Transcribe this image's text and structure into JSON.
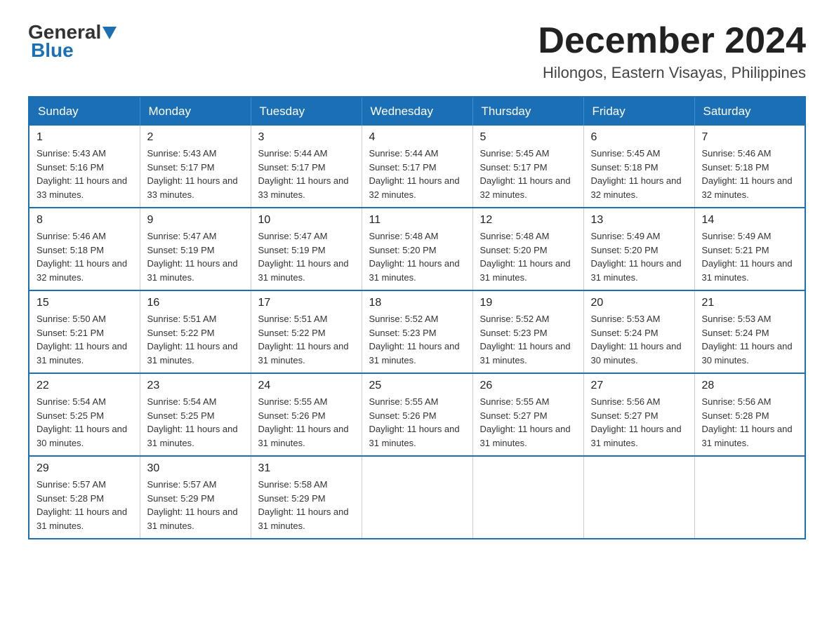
{
  "header": {
    "logo_general": "General",
    "logo_blue": "Blue",
    "title": "December 2024",
    "subtitle": "Hilongos, Eastern Visayas, Philippines"
  },
  "calendar": {
    "days_of_week": [
      "Sunday",
      "Monday",
      "Tuesday",
      "Wednesday",
      "Thursday",
      "Friday",
      "Saturday"
    ],
    "weeks": [
      [
        {
          "day": "1",
          "sunrise": "5:43 AM",
          "sunset": "5:16 PM",
          "daylight": "11 hours and 33 minutes."
        },
        {
          "day": "2",
          "sunrise": "5:43 AM",
          "sunset": "5:17 PM",
          "daylight": "11 hours and 33 minutes."
        },
        {
          "day": "3",
          "sunrise": "5:44 AM",
          "sunset": "5:17 PM",
          "daylight": "11 hours and 33 minutes."
        },
        {
          "day": "4",
          "sunrise": "5:44 AM",
          "sunset": "5:17 PM",
          "daylight": "11 hours and 32 minutes."
        },
        {
          "day": "5",
          "sunrise": "5:45 AM",
          "sunset": "5:17 PM",
          "daylight": "11 hours and 32 minutes."
        },
        {
          "day": "6",
          "sunrise": "5:45 AM",
          "sunset": "5:18 PM",
          "daylight": "11 hours and 32 minutes."
        },
        {
          "day": "7",
          "sunrise": "5:46 AM",
          "sunset": "5:18 PM",
          "daylight": "11 hours and 32 minutes."
        }
      ],
      [
        {
          "day": "8",
          "sunrise": "5:46 AM",
          "sunset": "5:18 PM",
          "daylight": "11 hours and 32 minutes."
        },
        {
          "day": "9",
          "sunrise": "5:47 AM",
          "sunset": "5:19 PM",
          "daylight": "11 hours and 31 minutes."
        },
        {
          "day": "10",
          "sunrise": "5:47 AM",
          "sunset": "5:19 PM",
          "daylight": "11 hours and 31 minutes."
        },
        {
          "day": "11",
          "sunrise": "5:48 AM",
          "sunset": "5:20 PM",
          "daylight": "11 hours and 31 minutes."
        },
        {
          "day": "12",
          "sunrise": "5:48 AM",
          "sunset": "5:20 PM",
          "daylight": "11 hours and 31 minutes."
        },
        {
          "day": "13",
          "sunrise": "5:49 AM",
          "sunset": "5:20 PM",
          "daylight": "11 hours and 31 minutes."
        },
        {
          "day": "14",
          "sunrise": "5:49 AM",
          "sunset": "5:21 PM",
          "daylight": "11 hours and 31 minutes."
        }
      ],
      [
        {
          "day": "15",
          "sunrise": "5:50 AM",
          "sunset": "5:21 PM",
          "daylight": "11 hours and 31 minutes."
        },
        {
          "day": "16",
          "sunrise": "5:51 AM",
          "sunset": "5:22 PM",
          "daylight": "11 hours and 31 minutes."
        },
        {
          "day": "17",
          "sunrise": "5:51 AM",
          "sunset": "5:22 PM",
          "daylight": "11 hours and 31 minutes."
        },
        {
          "day": "18",
          "sunrise": "5:52 AM",
          "sunset": "5:23 PM",
          "daylight": "11 hours and 31 minutes."
        },
        {
          "day": "19",
          "sunrise": "5:52 AM",
          "sunset": "5:23 PM",
          "daylight": "11 hours and 31 minutes."
        },
        {
          "day": "20",
          "sunrise": "5:53 AM",
          "sunset": "5:24 PM",
          "daylight": "11 hours and 30 minutes."
        },
        {
          "day": "21",
          "sunrise": "5:53 AM",
          "sunset": "5:24 PM",
          "daylight": "11 hours and 30 minutes."
        }
      ],
      [
        {
          "day": "22",
          "sunrise": "5:54 AM",
          "sunset": "5:25 PM",
          "daylight": "11 hours and 30 minutes."
        },
        {
          "day": "23",
          "sunrise": "5:54 AM",
          "sunset": "5:25 PM",
          "daylight": "11 hours and 31 minutes."
        },
        {
          "day": "24",
          "sunrise": "5:55 AM",
          "sunset": "5:26 PM",
          "daylight": "11 hours and 31 minutes."
        },
        {
          "day": "25",
          "sunrise": "5:55 AM",
          "sunset": "5:26 PM",
          "daylight": "11 hours and 31 minutes."
        },
        {
          "day": "26",
          "sunrise": "5:55 AM",
          "sunset": "5:27 PM",
          "daylight": "11 hours and 31 minutes."
        },
        {
          "day": "27",
          "sunrise": "5:56 AM",
          "sunset": "5:27 PM",
          "daylight": "11 hours and 31 minutes."
        },
        {
          "day": "28",
          "sunrise": "5:56 AM",
          "sunset": "5:28 PM",
          "daylight": "11 hours and 31 minutes."
        }
      ],
      [
        {
          "day": "29",
          "sunrise": "5:57 AM",
          "sunset": "5:28 PM",
          "daylight": "11 hours and 31 minutes."
        },
        {
          "day": "30",
          "sunrise": "5:57 AM",
          "sunset": "5:29 PM",
          "daylight": "11 hours and 31 minutes."
        },
        {
          "day": "31",
          "sunrise": "5:58 AM",
          "sunset": "5:29 PM",
          "daylight": "11 hours and 31 minutes."
        },
        null,
        null,
        null,
        null
      ]
    ],
    "labels": {
      "sunrise": "Sunrise:",
      "sunset": "Sunset:",
      "daylight": "Daylight:"
    }
  }
}
